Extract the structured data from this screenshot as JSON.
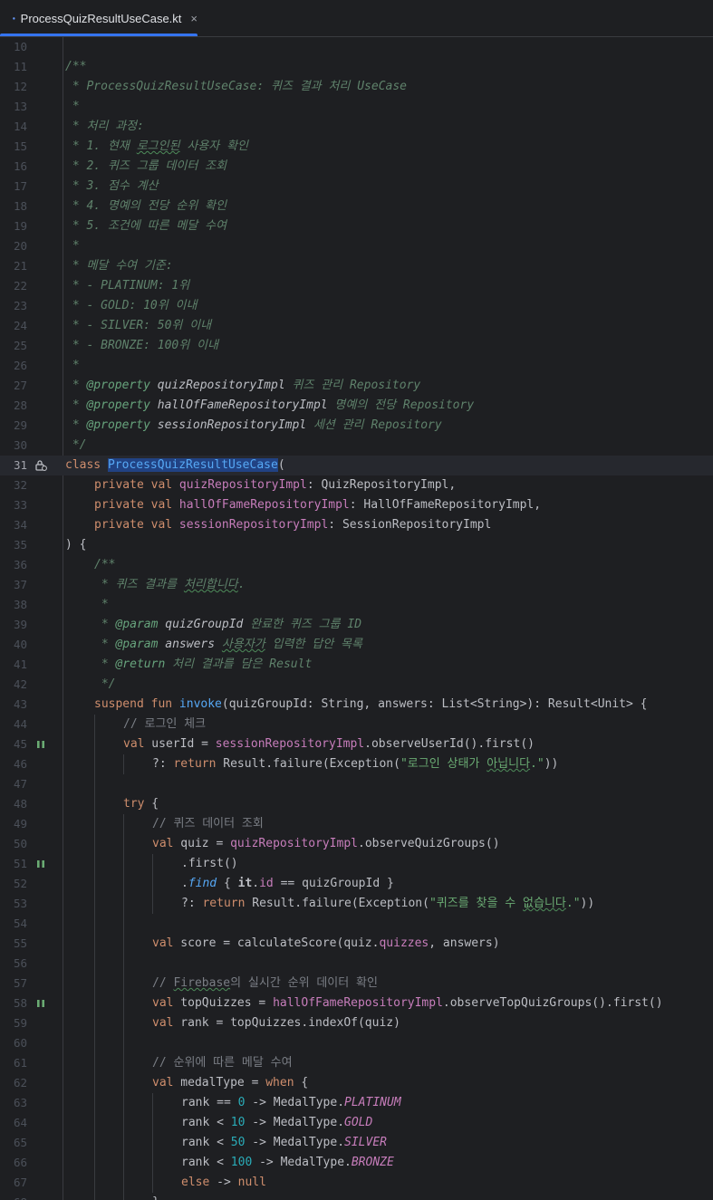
{
  "tab": {
    "title": "ProcessQuizResultUseCase.kt",
    "close_glyph": "×"
  },
  "colors": {
    "accent": "#3574f0",
    "keyword": "#cf8e6d",
    "function": "#56a8f5",
    "property": "#c77dbb",
    "string": "#6aab73",
    "number": "#2aacb8",
    "doc_comment": "#5f826b",
    "line_comment": "#7a7e85"
  },
  "lines": {
    "l10": {
      "n": "10"
    },
    "l11": {
      "n": "11",
      "t": "/**"
    },
    "l12": {
      "n": "12",
      "t": " * ProcessQuizResultUseCase: 퀴즈 결과 처리 UseCase"
    },
    "l13": {
      "n": "13",
      "t": " *"
    },
    "l14": {
      "n": "14",
      "t": " * 처리 과정:"
    },
    "l15": {
      "n": "15",
      "a": " * 1. 현재 ",
      "b": "로그인된",
      "c": " 사용자 확인"
    },
    "l16": {
      "n": "16",
      "t": " * 2. 퀴즈 그룹 데이터 조회"
    },
    "l17": {
      "n": "17",
      "t": " * 3. 점수 계산"
    },
    "l18": {
      "n": "18",
      "t": " * 4. 명예의 전당 순위 확인"
    },
    "l19": {
      "n": "19",
      "t": " * 5. 조건에 따른 메달 수여"
    },
    "l20": {
      "n": "20",
      "t": " *"
    },
    "l21": {
      "n": "21",
      "t": " * 메달 수여 기준:"
    },
    "l22": {
      "n": "22",
      "t": " * - PLATINUM: 1위"
    },
    "l23": {
      "n": "23",
      "t": " * - GOLD: 10위 이내"
    },
    "l24": {
      "n": "24",
      "t": " * - SILVER: 50위 이내"
    },
    "l25": {
      "n": "25",
      "t": " * - BRONZE: 100위 이내"
    },
    "l26": {
      "n": "26",
      "t": " *"
    },
    "l27": {
      "n": "27",
      "a": " * ",
      "tag": "@property",
      "name": " quizRepositoryImpl",
      "desc": " 퀴즈 관리 Repository"
    },
    "l28": {
      "n": "28",
      "a": " * ",
      "tag": "@property",
      "name": " hallOfFameRepositoryImpl",
      "desc": " 명예의 전당 Repository"
    },
    "l29": {
      "n": "29",
      "a": " * ",
      "tag": "@property",
      "name": " sessionRepositoryImpl",
      "desc": " 세션 관리 Repository"
    },
    "l30": {
      "n": "30",
      "t": " */"
    },
    "l31": {
      "n": "31",
      "kw": "class",
      "sp": " ",
      "name": "ProcessQuizResultUseCase",
      "rest": "("
    },
    "l32": {
      "n": "32",
      "kw": "private val",
      "prop": "quizRepositoryImpl",
      "rest": ": QuizRepositoryImpl,"
    },
    "l33": {
      "n": "33",
      "kw": "private val",
      "prop": "hallOfFameRepositoryImpl",
      "rest": ": HallOfFameRepositoryImpl,"
    },
    "l34": {
      "n": "34",
      "kw": "private val",
      "prop": "sessionRepositoryImpl",
      "rest": ": SessionRepositoryImpl"
    },
    "l35": {
      "n": "35",
      "t": ") {"
    },
    "l36": {
      "n": "36",
      "t": "/**"
    },
    "l37": {
      "n": "37",
      "a": " * 퀴즈 결과를 ",
      "b": "처리합니다",
      "c": "."
    },
    "l38": {
      "n": "38",
      "t": " *"
    },
    "l39": {
      "n": "39",
      "a": " * ",
      "tag": "@param",
      "name": " quizGroupId",
      "desc": " 완료한 퀴즈 그룹 ID"
    },
    "l40": {
      "n": "40",
      "a": " * ",
      "tag": "@param",
      "name": " answers",
      "sp": " ",
      "desc_typo": "사용자가",
      "desc": " 입력한 답안 목록"
    },
    "l41": {
      "n": "41",
      "a": " * ",
      "tag": "@return",
      "desc": " 처리 결과를 담은 Result"
    },
    "l42": {
      "n": "42",
      "t": " */"
    },
    "l43": {
      "n": "43",
      "kw": "suspend fun",
      "fn": "invoke",
      "rest": "(quizGroupId: String, answers: List<String>): Result<Unit> {"
    },
    "l44": {
      "n": "44",
      "t": "// 로그인 체크"
    },
    "l45": {
      "n": "45",
      "kw": "val",
      "mid": " userId = ",
      "prop": "sessionRepositoryImpl",
      "rest": ".observeUserId().first()"
    },
    "l46": {
      "n": "46",
      "a": "?: ",
      "kw": "return",
      "mid": " Result.failure(Exception(",
      "str1": "\"로그인 상태가 ",
      "typo": "아닙니다",
      "str2": ".\"",
      "rest": "))"
    },
    "l47": {
      "n": "47"
    },
    "l48": {
      "n": "48",
      "kw": "try",
      "rest": " {"
    },
    "l49": {
      "n": "49",
      "t": "// 퀴즈 데이터 조회"
    },
    "l50": {
      "n": "50",
      "kw": "val",
      "mid": " quiz = ",
      "prop": "quizRepositoryImpl",
      "rest": ".observeQuizGroups()"
    },
    "l51": {
      "n": "51",
      "t": ".first()"
    },
    "l52": {
      "n": "52",
      "dot": ".",
      "fn": "find",
      "b1": " { ",
      "it": "it",
      "dot2": ".",
      "prop": "id",
      "rest": " == quizGroupId }"
    },
    "l53": {
      "n": "53",
      "a": "?: ",
      "kw": "return",
      "mid": " Result.failure(Exception(",
      "str1": "\"퀴즈를 찾을 수 ",
      "typo": "없습니다",
      "str2": ".\"",
      "rest": "))"
    },
    "l54": {
      "n": "54"
    },
    "l55": {
      "n": "55",
      "kw": "val",
      "mid": " score = calculateScore(quiz.",
      "prop": "quizzes",
      "rest": ", answers)"
    },
    "l56": {
      "n": "56"
    },
    "l57": {
      "n": "57",
      "a": "// ",
      "typo": "Firebase",
      "b": "의 실시간 순위 데이터 확인"
    },
    "l58": {
      "n": "58",
      "kw": "val",
      "mid": " topQuizzes = ",
      "prop": "hallOfFameRepositoryImpl",
      "rest": ".observeTopQuizGroups().first()"
    },
    "l59": {
      "n": "59",
      "kw": "val",
      "rest": " rank = topQuizzes.indexOf(quiz)"
    },
    "l60": {
      "n": "60"
    },
    "l61": {
      "n": "61",
      "t": "// 순위에 따른 메달 수여"
    },
    "l62": {
      "n": "62",
      "kw": "val",
      "mid": " medalType = ",
      "kw2": "when",
      "rest": " {"
    },
    "l63": {
      "n": "63",
      "a": "rank == ",
      "num": "0",
      "b": " -> MedalType.",
      "enum": "PLATINUM"
    },
    "l64": {
      "n": "64",
      "a": "rank < ",
      "num": "10",
      "b": " -> MedalType.",
      "enum": "GOLD"
    },
    "l65": {
      "n": "65",
      "a": "rank < ",
      "num": "50",
      "b": " -> MedalType.",
      "enum": "SILVER"
    },
    "l66": {
      "n": "66",
      "a": "rank < ",
      "num": "100",
      "b": " -> MedalType.",
      "enum": "BRONZE"
    },
    "l67": {
      "n": "67",
      "kw": "else",
      "b": " -> ",
      "kw2": "null"
    },
    "l68": {
      "n": "68",
      "t": "}"
    }
  }
}
